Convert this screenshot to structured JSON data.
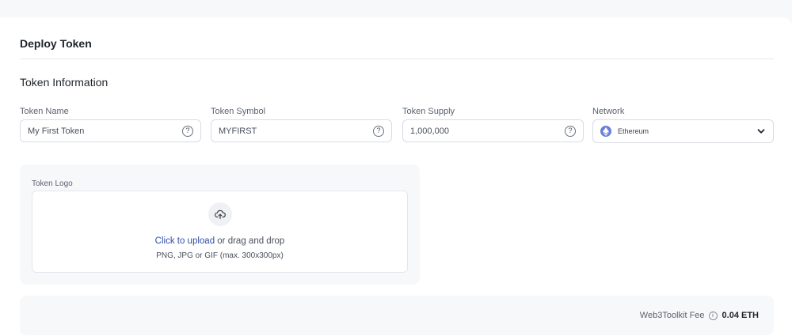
{
  "page": {
    "title": "Deploy Token",
    "section_title": "Token Information"
  },
  "fields": [
    {
      "label": "Token Name",
      "value": "My First Token",
      "icon": "help-icon"
    },
    {
      "label": "Token Symbol",
      "value": "MYFIRST",
      "icon": "help-icon"
    },
    {
      "label": "Token Supply",
      "value": "1,000,000",
      "icon": "help-icon"
    }
  ],
  "network": {
    "label": "Network",
    "selected": "Ethereum",
    "icon": "ethereum-icon"
  },
  "logo": {
    "label": "Token Logo",
    "upload_link": "Click to upload",
    "upload_rest": " or drag and drop",
    "upload_hint": "PNG, JPG or GIF (max. 300x300px)",
    "icon": "cloud-upload-icon"
  },
  "fee": {
    "label": "Web3Toolkit Fee",
    "value": "0.04 ETH",
    "icon": "info-icon"
  },
  "colors": {
    "accent_link": "#2f4fa8",
    "ethereum": "#6a7fd8",
    "panel_bg": "#f7f8fa"
  }
}
